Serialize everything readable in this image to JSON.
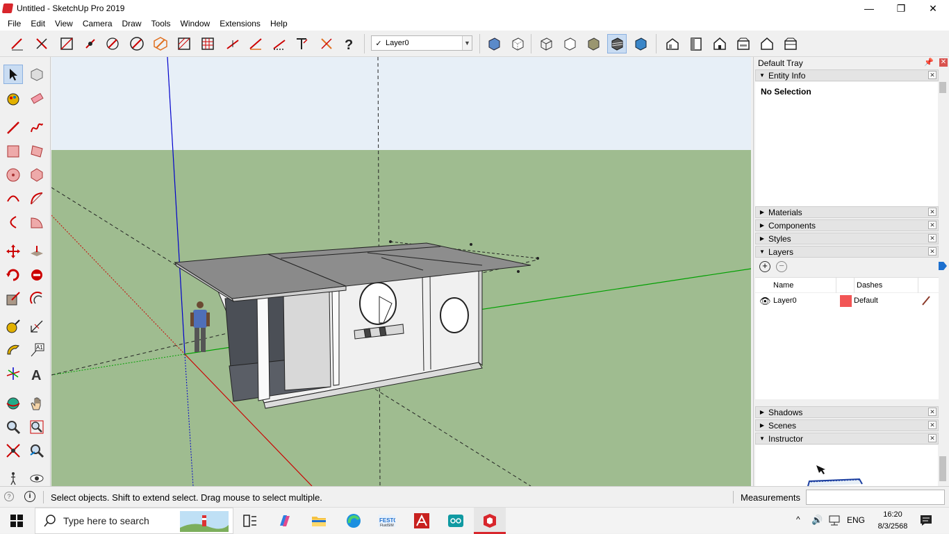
{
  "window": {
    "title": "Untitled - SketchUp Pro 2019",
    "minimize": "—",
    "restore": "❐",
    "close": "✕"
  },
  "menu": [
    "File",
    "Edit",
    "View",
    "Camera",
    "Draw",
    "Tools",
    "Window",
    "Extensions",
    "Help"
  ],
  "toolbar": {
    "layer_selected": "Layer0",
    "layer_check": "✓",
    "dropdown_arrow": "▼"
  },
  "tray": {
    "title": "Default Tray",
    "pin": "📌",
    "close": "✕",
    "entity_info": {
      "label": "Entity Info",
      "content": "No Selection"
    },
    "panels": [
      "Materials",
      "Components",
      "Styles"
    ],
    "layers": {
      "label": "Layers",
      "col_name": "Name",
      "col_dashes": "Dashes",
      "rows": [
        {
          "name": "Layer0",
          "color": "#f25555",
          "dashes": "Default"
        }
      ]
    },
    "panels_bottom": [
      "Shadows",
      "Scenes"
    ],
    "instructor": {
      "label": "Instructor"
    }
  },
  "status": {
    "message": "Select objects. Shift to extend select. Drag mouse to select multiple.",
    "measurements_label": "Measurements",
    "measurements_value": ""
  },
  "taskbar": {
    "search_placeholder": "Type here to search",
    "language": "ENG",
    "time": "16:20",
    "date": "8/3/2568"
  },
  "colors": {
    "sky": "#e7eff7",
    "ground": "#9fbc90",
    "axis_red": "#cc0000",
    "axis_green": "#00a000",
    "axis_blue": "#0000cc",
    "brand": "#d8262c"
  }
}
